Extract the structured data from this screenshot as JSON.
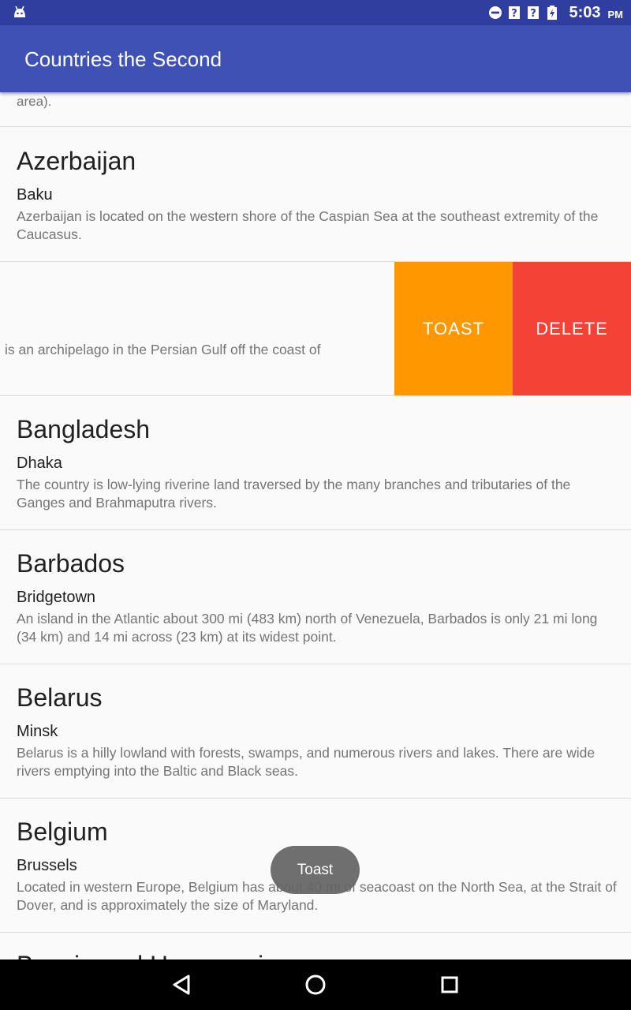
{
  "status_bar": {
    "time": "5:03",
    "ampm": "PM",
    "icons": [
      "android-debug-icon",
      "do-not-disturb-icon",
      "unknown-signal-icon",
      "unknown-wifi-icon",
      "battery-charging-icon"
    ]
  },
  "app_bar": {
    "title": "Countries the Second"
  },
  "list": {
    "partial_top": {
      "description": "area)."
    },
    "items": [
      {
        "name": "Azerbaijan",
        "capital": "Baku",
        "description": "Azerbaijan is located on the western shore of the Caspian Sea at the southeast extremity of the Caucasus."
      },
      {
        "description_visible": "is an archipelago in the Persian Gulf off the coast of",
        "swiped": true
      },
      {
        "name": "Bangladesh",
        "capital": "Dhaka",
        "description": "The country is low-lying riverine land traversed by the many branches and tributaries of the Ganges and Brahmaputra rivers."
      },
      {
        "name": "Barbados",
        "capital": "Bridgetown",
        "description": "An island in the Atlantic about 300 mi (483 km) north of Venezuela, Barbados is only 21 mi long (34 km) and 14 mi across (23 km) at its widest point."
      },
      {
        "name": "Belarus",
        "capital": "Minsk",
        "description": "Belarus is a hilly lowland with forests, swamps, and numerous rivers and lakes. There are wide rivers emptying into the Baltic and Black seas."
      },
      {
        "name": "Belgium",
        "capital": "Brussels",
        "description": "Located in western Europe, Belgium has about 40 mi of seacoast on the North Sea, at the Strait of Dover, and is approximately the size of Maryland."
      }
    ],
    "next_peek": "Bosnia and Herzegovina"
  },
  "swipe_actions": {
    "toast_label": "TOAST",
    "delete_label": "DELETE"
  },
  "colors": {
    "status_bar": "#303f9f",
    "app_bar": "#3f51b5",
    "toast_action": "#ff9800",
    "delete_action": "#f44336"
  },
  "toast": {
    "message": "Toast"
  },
  "nav_bar": {
    "icons": [
      "back-icon",
      "home-icon",
      "recents-icon"
    ]
  }
}
